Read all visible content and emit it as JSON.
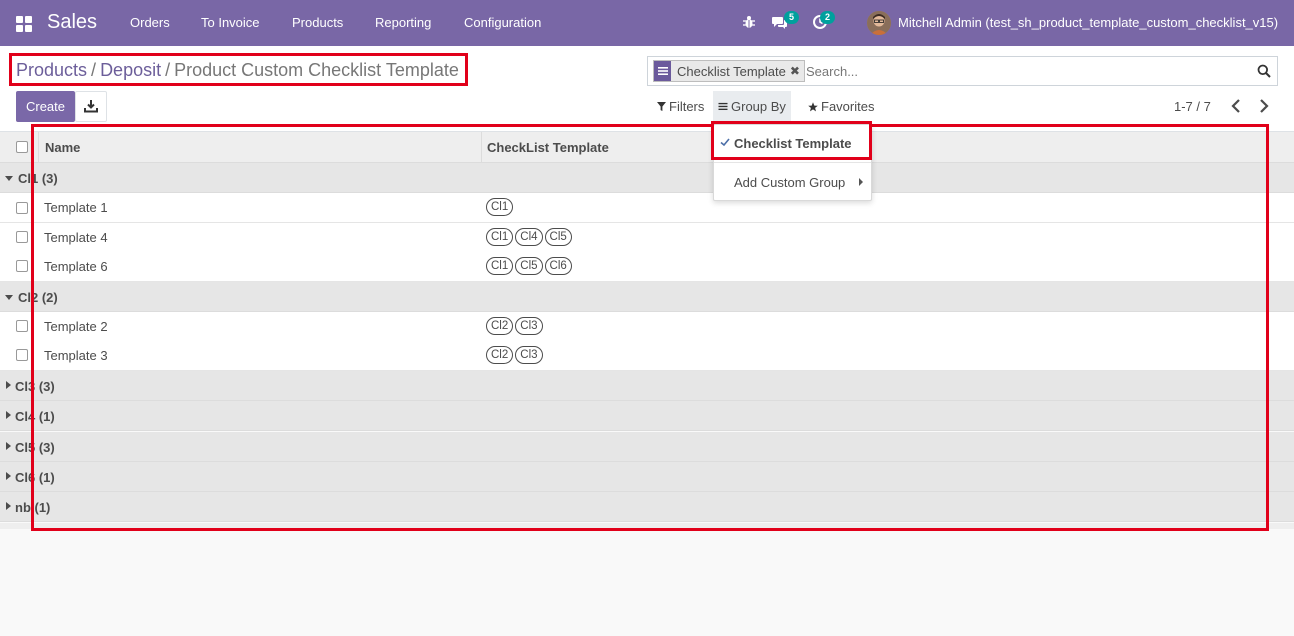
{
  "navbar": {
    "app_name": "Sales",
    "menu": [
      "Orders",
      "To Invoice",
      "Products",
      "Reporting",
      "Configuration"
    ],
    "messages_count": "5",
    "activities_count": "2",
    "user_name": "Mitchell Admin (test_sh_product_template_custom_checklist_v15)"
  },
  "breadcrumb": {
    "items": [
      "Products",
      "Deposit"
    ],
    "separator": "/",
    "current": "Product Custom Checklist Template"
  },
  "toolbar": {
    "create_label": "Create"
  },
  "search": {
    "facet_label": "Checklist Template",
    "placeholder": "Search..."
  },
  "filters": {
    "filters_label": "Filters",
    "groupby_label": "Group By",
    "favorites_label": "Favorites"
  },
  "pager": {
    "range": "1-7 / 7"
  },
  "groupby_menu": {
    "selected_item": "Checklist Template",
    "custom_group_label": "Add Custom Group"
  },
  "list": {
    "columns": [
      "Name",
      "CheckList Template"
    ],
    "groups": [
      {
        "label": "Cl1 (3)",
        "expanded": true,
        "rows": [
          {
            "name": "Template 1",
            "tags": [
              "Cl1"
            ]
          },
          {
            "name": "Template 4",
            "tags": [
              "Cl1",
              "Cl4",
              "Cl5"
            ]
          },
          {
            "name": "Template 6",
            "tags": [
              "Cl1",
              "Cl5",
              "Cl6"
            ]
          }
        ]
      },
      {
        "label": "Cl2 (2)",
        "expanded": true,
        "rows": [
          {
            "name": "Template 2",
            "tags": [
              "Cl2",
              "Cl3"
            ]
          },
          {
            "name": "Template 3",
            "tags": [
              "Cl2",
              "Cl3"
            ]
          }
        ]
      },
      {
        "label": "Cl3 (3)",
        "expanded": false,
        "rows": []
      },
      {
        "label": "Cl4 (1)",
        "expanded": false,
        "rows": []
      },
      {
        "label": "Cl5 (3)",
        "expanded": false,
        "rows": []
      },
      {
        "label": "Cl6 (1)",
        "expanded": false,
        "rows": []
      },
      {
        "label": "nb (1)",
        "expanded": false,
        "rows": []
      }
    ]
  },
  "colors": {
    "navbar": "#7967a6",
    "primary": "#7a68a8",
    "highlight": "#e1001a",
    "badge": "#00a09d"
  }
}
